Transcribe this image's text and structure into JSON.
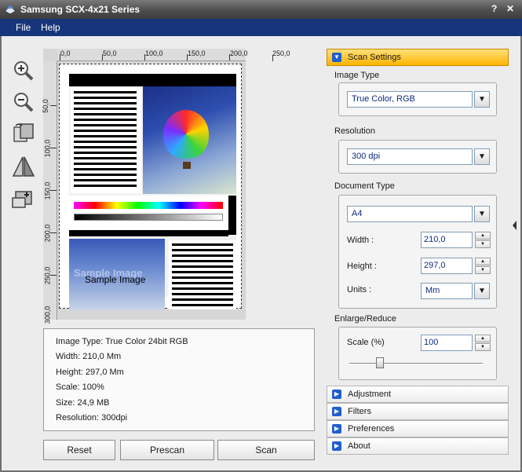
{
  "window": {
    "title": "Samsung SCX-4x21 Series",
    "help_btn": "?",
    "close_btn": "✕"
  },
  "menu": {
    "file": "File",
    "help": "Help"
  },
  "toolbar": {
    "icons": [
      "zoom-in-icon",
      "zoom-out-icon",
      "rotate-icon",
      "flip-icon",
      "crop-icon"
    ]
  },
  "ruler": {
    "h": [
      "0,0",
      "50,0",
      "100,0",
      "150,0",
      "200,0",
      "250,0"
    ],
    "v": [
      "50,0",
      "100,0",
      "150,0",
      "200,0",
      "250,0",
      "300,0"
    ]
  },
  "preview": {
    "sample_text": "Sample Image",
    "watermark": "Sample Image"
  },
  "info": {
    "image_type": "Image Type: True Color 24bit RGB",
    "width": "Width: 210,0 Mm",
    "height": "Height: 297,0 Mm",
    "scale": "Scale: 100%",
    "size": "Size: 24,9 MB",
    "resolution": "Resolution: 300dpi"
  },
  "buttons": {
    "reset": "Reset",
    "prescan": "Prescan",
    "scan": "Scan"
  },
  "settings": {
    "header": "Scan Settings",
    "image_type_label": "Image Type",
    "image_type_value": "True Color, RGB",
    "resolution_label": "Resolution",
    "resolution_value": "300 dpi",
    "doc_type_label": "Document Type",
    "doc_type_value": "A4",
    "width_label": "Width :",
    "width_value": "210,0",
    "height_label": "Height :",
    "height_value": "297,0",
    "units_label": "Units :",
    "units_value": "Mm",
    "enlarge_label": "Enlarge/Reduce",
    "scale_label": "Scale (%)",
    "scale_value": "100",
    "scale_fraction": 0.2
  },
  "sections": {
    "adjustment": "Adjustment",
    "filters": "Filters",
    "preferences": "Preferences",
    "about": "About"
  }
}
